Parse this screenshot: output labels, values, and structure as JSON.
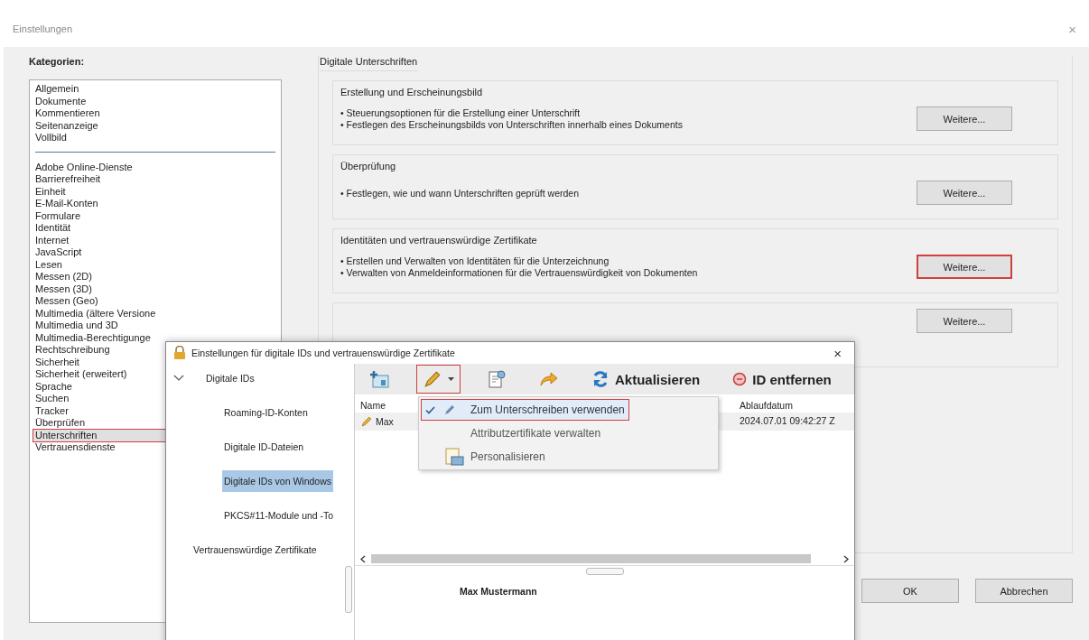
{
  "window": {
    "title": "Einstellungen",
    "close": "×"
  },
  "categories": {
    "label": "Kategorien:",
    "groups": [
      {
        "items": [
          {
            "label": "Allgemein",
            "selected": false,
            "highlighted": false
          },
          {
            "label": "Dokumente",
            "selected": false,
            "highlighted": false
          },
          {
            "label": "Kommentieren",
            "selected": false,
            "highlighted": false
          },
          {
            "label": "Seitenanzeige",
            "selected": false,
            "highlighted": false
          },
          {
            "label": "Vollbild",
            "selected": false,
            "highlighted": false
          }
        ]
      },
      {
        "items": [
          {
            "label": "Adobe Online-Dienste",
            "selected": false,
            "highlighted": false
          },
          {
            "label": "Barrierefreiheit",
            "selected": false,
            "highlighted": false
          },
          {
            "label": "Einheit",
            "selected": false,
            "highlighted": false
          },
          {
            "label": "E-Mail-Konten",
            "selected": false,
            "highlighted": false
          },
          {
            "label": "Formulare",
            "selected": false,
            "highlighted": false
          },
          {
            "label": "Identität",
            "selected": false,
            "highlighted": false
          },
          {
            "label": "Internet",
            "selected": false,
            "highlighted": false
          },
          {
            "label": "JavaScript",
            "selected": false,
            "highlighted": false
          },
          {
            "label": "Lesen",
            "selected": false,
            "highlighted": false
          },
          {
            "label": "Messen (2D)",
            "selected": false,
            "highlighted": false
          },
          {
            "label": "Messen (3D)",
            "selected": false,
            "highlighted": false
          },
          {
            "label": "Messen (Geo)",
            "selected": false,
            "highlighted": false
          },
          {
            "label": "Multimedia (ältere Versione",
            "selected": false,
            "highlighted": false
          },
          {
            "label": "Multimedia und 3D",
            "selected": false,
            "highlighted": false
          },
          {
            "label": "Multimedia-Berechtigunge",
            "selected": false,
            "highlighted": false
          },
          {
            "label": "Rechtschreibung",
            "selected": false,
            "highlighted": false
          },
          {
            "label": "Sicherheit",
            "selected": false,
            "highlighted": false
          },
          {
            "label": "Sicherheit (erweitert)",
            "selected": false,
            "highlighted": false
          },
          {
            "label": "Sprache",
            "selected": false,
            "highlighted": false
          },
          {
            "label": "Suchen",
            "selected": false,
            "highlighted": false
          },
          {
            "label": "Tracker",
            "selected": false,
            "highlighted": false
          },
          {
            "label": "Überprüfen",
            "selected": false,
            "highlighted": false
          },
          {
            "label": "Unterschriften",
            "selected": true,
            "highlighted": true
          },
          {
            "label": "Vertrauensdienste",
            "selected": false,
            "highlighted": false
          }
        ]
      }
    ]
  },
  "digital_signatures": {
    "title": "Digitale Unterschriften",
    "sections": [
      {
        "title": "Erstellung und Erscheinungsbild",
        "bullets": [
          "• Steuerungsoptionen für die Erstellung einer Unterschrift",
          "• Festlegen des Erscheinungsbilds von Unterschriften innerhalb eines Dokuments"
        ],
        "button": {
          "label": "Weitere...",
          "highlighted": false
        }
      },
      {
        "title": "Überprüfung",
        "bullets": [
          "• Festlegen, wie und wann Unterschriften geprüft werden"
        ],
        "button": {
          "label": "Weitere...",
          "highlighted": false
        }
      },
      {
        "title": "Identitäten und vertrauenswürdige Zertifikate",
        "bullets": [
          "• Erstellen und Verwalten von Identitäten für die Unterzeichnung",
          "• Verwalten von Anmeldeinformationen für die Vertrauenswürdigkeit von Dokumenten"
        ],
        "button": {
          "label": "Weitere...",
          "highlighted": true
        }
      },
      {
        "button": {
          "label": "Weitere...",
          "highlighted": false
        }
      }
    ]
  },
  "buttons": [
    {
      "label": "OK"
    },
    {
      "label": "Abbrechen"
    }
  ],
  "dialog": {
    "title": "Einstellungen für digitale IDs und vertrauenswürdige Zertifikate",
    "close": "×",
    "tree": [
      {
        "label": "Digitale IDs",
        "expanded": true,
        "selected": false,
        "children": [
          {
            "label": "Roaming-ID-Konten",
            "selected": false
          },
          {
            "label": "Digitale ID-Dateien",
            "selected": false
          },
          {
            "label": "Digitale IDs von Windows",
            "selected": true
          },
          {
            "label": "PKCS#11-Module und -To",
            "selected": false
          }
        ]
      },
      {
        "label": "Vertrauenswürdige Zertifikate",
        "selected": false
      }
    ],
    "toolbar": [
      {
        "kind": "add-id",
        "highlighted": false
      },
      {
        "kind": "pen",
        "highlighted": true
      },
      {
        "kind": "certificate",
        "highlighted": false
      },
      {
        "kind": "export",
        "highlighted": false
      },
      {
        "kind": "refresh",
        "label": "Aktualisieren",
        "highlighted": false
      },
      {
        "kind": "remove",
        "label": "ID entfernen",
        "highlighted": false
      }
    ],
    "table": {
      "columns": [
        "Name",
        "Ablaufdatum"
      ],
      "rows": [
        {
          "name": "Max",
          "expires": "2024.07.01 09:42:27 Z",
          "selected": true
        }
      ]
    },
    "menu": [
      {
        "label": "Zum Unterschreiben verwenden",
        "checked": true,
        "highlighted": true
      },
      {
        "label": "Attributzertifikate verwalten",
        "checked": false,
        "highlighted": false
      },
      {
        "label": "Personalisieren",
        "checked": false,
        "highlighted": false
      }
    ],
    "detail": "Max Mustermann"
  }
}
